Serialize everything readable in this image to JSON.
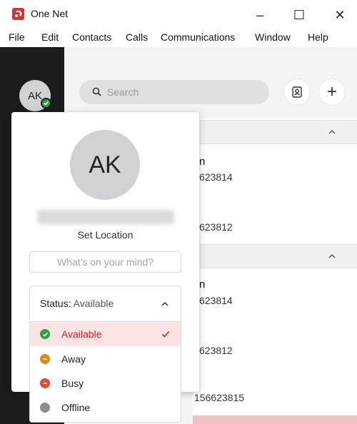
{
  "window": {
    "title": "One Net",
    "controls": {
      "minimize": "–",
      "maximize": "☐",
      "close": "✕"
    },
    "brand_color": "#e52b2b"
  },
  "menu": {
    "items": [
      "File",
      "Edit",
      "Contacts",
      "Calls",
      "Communications",
      "Window",
      "Help"
    ]
  },
  "user": {
    "initials": "AK",
    "presence_color": "#2ea043"
  },
  "search": {
    "placeholder": "Search"
  },
  "actions": {
    "contacts_icon": "contact-card-icon",
    "add_label": "+"
  },
  "contacts": {
    "items": [
      {
        "name": "n",
        "number": "623814"
      },
      {
        "number": "623812"
      },
      {
        "name": "n",
        "number": "623814"
      },
      {
        "number": "623812"
      },
      {
        "number": "156623815"
      }
    ]
  },
  "profile_popover": {
    "initials": "AK",
    "set_location": "Set Location",
    "mind_placeholder": "What's on your mind?",
    "status": {
      "key": "Status:",
      "current": "Available",
      "options": [
        {
          "label": "Available",
          "color": "#2ea043",
          "selected": true
        },
        {
          "label": "Away",
          "color": "#d98a1c",
          "selected": false
        },
        {
          "label": "Busy",
          "color": "#e5483b",
          "selected": false
        },
        {
          "label": "Offline",
          "color": "#8c8c8c",
          "selected": false
        }
      ],
      "selected_color": "#d42020",
      "selected_bg": "#fde3e3"
    }
  }
}
